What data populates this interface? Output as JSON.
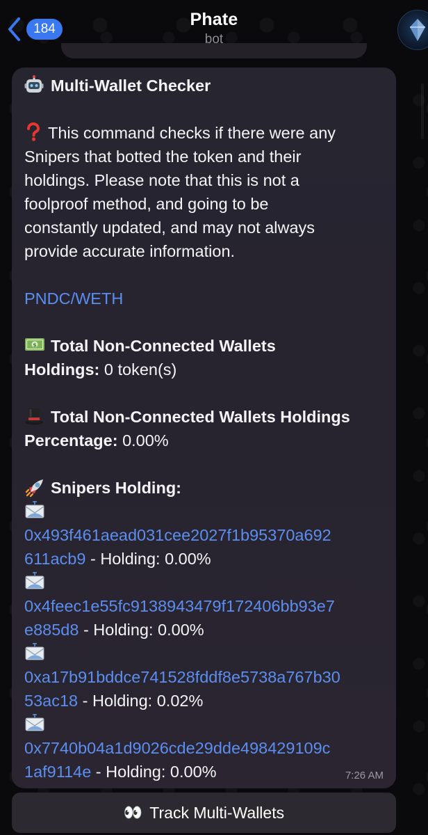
{
  "header": {
    "back_count": "184",
    "title": "Phate",
    "subtitle": "bot"
  },
  "message": {
    "title": "Multi-Wallet Checker",
    "description_lines": [
      "This command checks if there were any",
      "Snipers that botted the token and their",
      "holdings. Please note that this is not a",
      "foolproof method, and going to be",
      "constantly updated, and may not always",
      "provide accurate information."
    ],
    "pair": "PNDC/WETH",
    "holdings_title_1": "Total Non-Connected Wallets",
    "holdings_label": "Holdings:",
    "holdings_value": "0 token(s)",
    "percentage_title": "Total Non-Connected Wallets Holdings",
    "percentage_label": "Percentage:",
    "percentage_value": "0.00%",
    "snipers_title": "Snipers Holding:",
    "snipers": [
      {
        "addr_line1": "0x493f461aead031cee2027f1b95370a692",
        "addr_line2": "611acb9",
        "holding": " - Holding: 0.00%"
      },
      {
        "addr_line1": "0x4feec1e55fc9138943479f172406bb93e7",
        "addr_line2": "e885d8",
        "holding": " - Holding: 0.00%"
      },
      {
        "addr_line1": "0xa17b91bddce741528fddf8e5738a767b30",
        "addr_line2": "53ac18",
        "holding": " - Holding: 0.02%"
      },
      {
        "addr_line1": "0x7740b04a1d9026cde29dde498429109c",
        "addr_line2": "1af9114e",
        "holding": " - Holding: 0.00%"
      }
    ],
    "timestamp": "7:26 AM"
  },
  "keyboard": {
    "button_label": "Track Multi-Wallets",
    "button_emoji": "👀"
  },
  "icons": {
    "title_emoji": "robot-face-icon",
    "description_emoji": "red-question-mark-icon",
    "holdings_emoji": "dollar-banknote-icon",
    "percentage_emoji": "top-hat-icon",
    "snipers_emoji": "rocket-icon",
    "sniper_item_emoji": "incoming-envelope-icon",
    "avatar": "crystal-logo-icon"
  },
  "colors": {
    "accent_blue": "#3a78f2",
    "link_blue": "#5b8ef0",
    "background": "#0a090b",
    "bubble": "#262530"
  }
}
